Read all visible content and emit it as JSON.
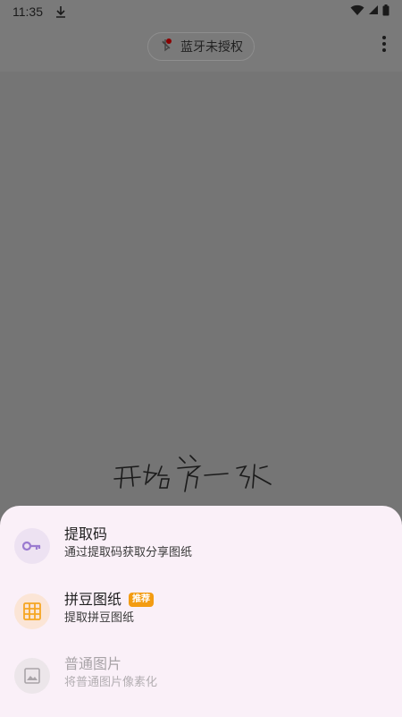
{
  "status_bar": {
    "time": "11:35"
  },
  "toolbar": {
    "bluetooth_chip": "蓝牙未授权"
  },
  "sheet": {
    "options": [
      {
        "title": "提取码",
        "subtitle": "通过提取码获取分享图纸",
        "icon": "key-icon",
        "color": "#9b7bd0",
        "enabled": true
      },
      {
        "title": "拼豆图纸",
        "badge": "推荐",
        "subtitle": "提取拼豆图纸",
        "icon": "grid-icon",
        "color": "#f5a623",
        "enabled": true
      },
      {
        "title": "普通图片",
        "subtitle": "将普通图片像素化",
        "icon": "image-icon",
        "color": "#9e9e9e",
        "enabled": false
      }
    ]
  },
  "colors": {
    "sheet_bg": "#faf0f8",
    "scrim": "#757575",
    "badge": "#f39c12"
  }
}
